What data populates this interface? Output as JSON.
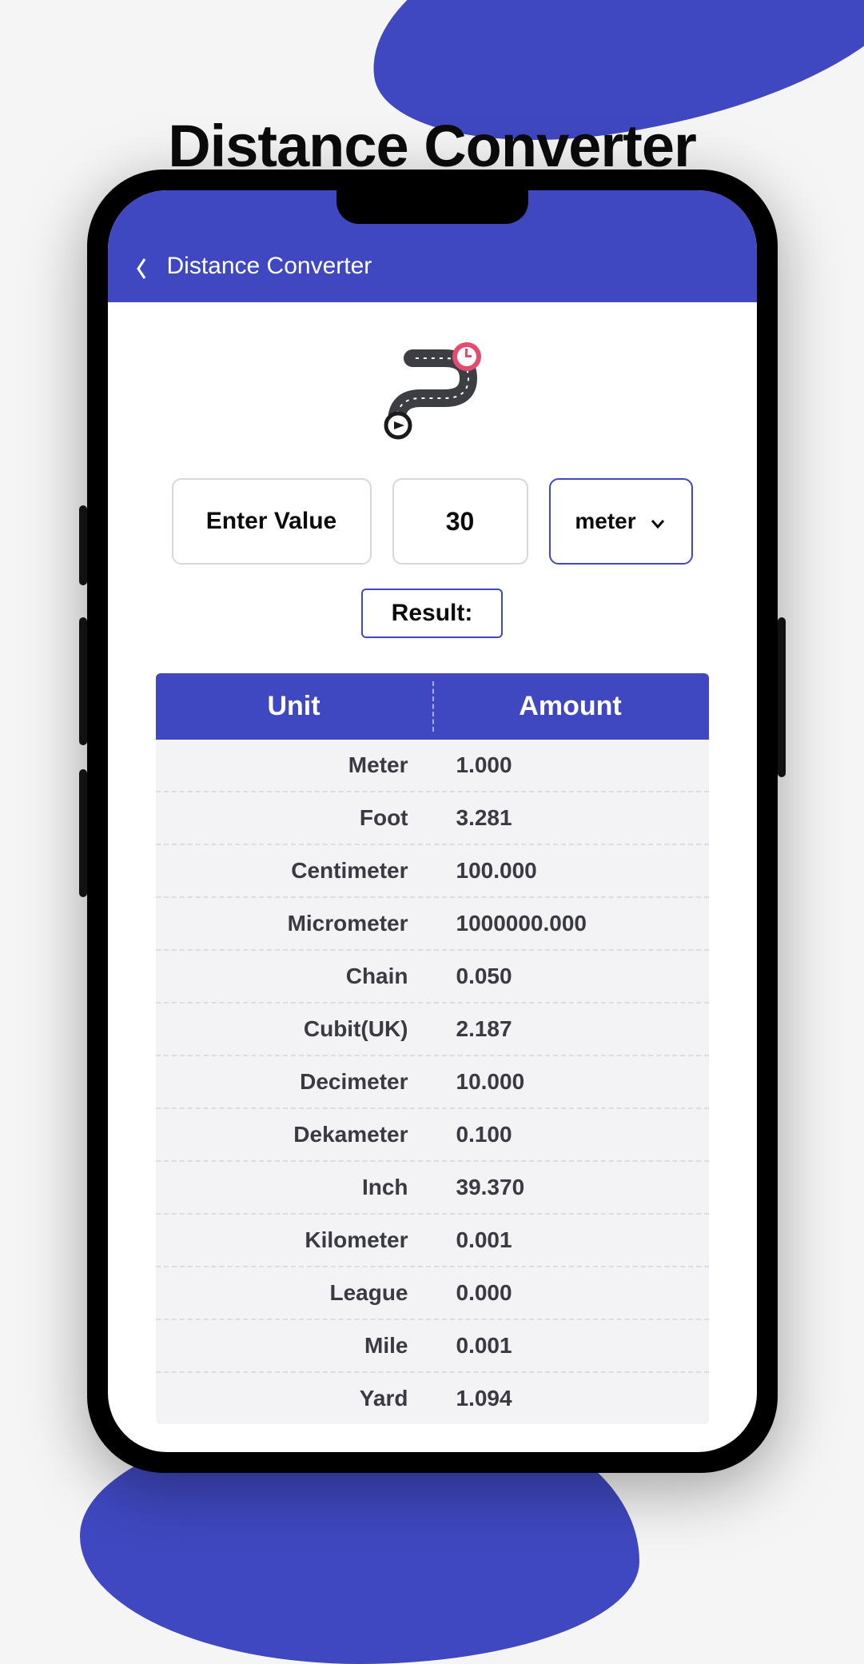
{
  "page": {
    "title": "Distance Converter"
  },
  "app": {
    "header_title": "Distance Converter"
  },
  "controls": {
    "value_label": "Enter Value",
    "value": "30",
    "unit_selected": "meter",
    "result_label": "Result:"
  },
  "table": {
    "header_unit": "Unit",
    "header_amount": "Amount",
    "rows": [
      {
        "unit": "Meter",
        "amount": "1.000"
      },
      {
        "unit": "Foot",
        "amount": "3.281"
      },
      {
        "unit": "Centimeter",
        "amount": "100.000"
      },
      {
        "unit": "Micrometer",
        "amount": "1000000.000"
      },
      {
        "unit": "Chain",
        "amount": "0.050"
      },
      {
        "unit": "Cubit(UK)",
        "amount": "2.187"
      },
      {
        "unit": "Decimeter",
        "amount": "10.000"
      },
      {
        "unit": "Dekameter",
        "amount": "0.100"
      },
      {
        "unit": "Inch",
        "amount": "39.370"
      },
      {
        "unit": "Kilometer",
        "amount": "0.001"
      },
      {
        "unit": "League",
        "amount": "0.000"
      },
      {
        "unit": "Mile",
        "amount": "0.001"
      },
      {
        "unit": "Yard",
        "amount": "1.094"
      }
    ]
  },
  "colors": {
    "accent": "#3f48c0"
  }
}
